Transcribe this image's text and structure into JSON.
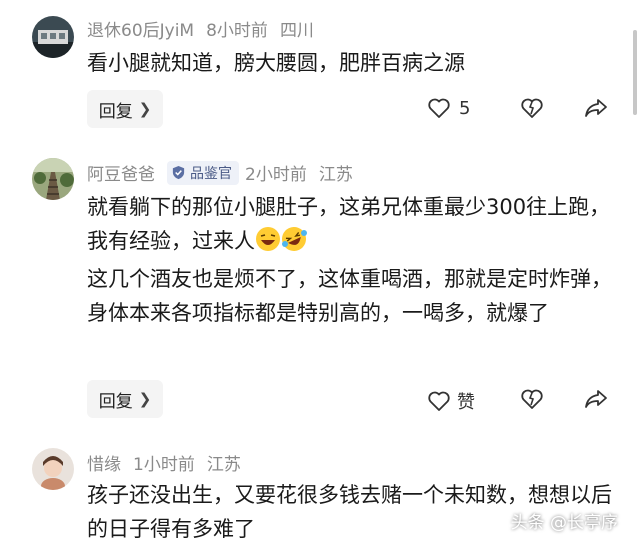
{
  "comments": [
    {
      "username": "退休60后JyiM",
      "time": "8小时前",
      "location": "四川",
      "text": "看小腿就知道，膀大腰圆，肥胖百病之源",
      "reply_label": "回复",
      "like_count": "5"
    },
    {
      "username": "阿豆爸爸",
      "badge": "品鉴官",
      "time": "2小时前",
      "location": "江苏",
      "text_line1": "就看躺下的那位小腿肚子，这弟兄体重最少300往上跑，我有经验，过来人",
      "text_line2": "这几个酒友也是烦不了，这体重喝酒，那就是定时炸弹，身体本来各项指标都是特别高的，一喝多，就爆了",
      "reply_label": "回复",
      "like_label": "赞"
    },
    {
      "username": "惜缘",
      "time": "1小时前",
      "location": "江苏",
      "text": "孩子还没出生，又要花很多钱去赌一个未知数，想想以后的日子得有多难了"
    }
  ],
  "watermark": "头条 @长亭序",
  "icons": [
    "chevron-right-icon",
    "heart-icon",
    "dislike-heart-icon",
    "share-icon",
    "verified-shield-icon",
    "laughing-emoji",
    "rolling-laugh-emoji"
  ]
}
